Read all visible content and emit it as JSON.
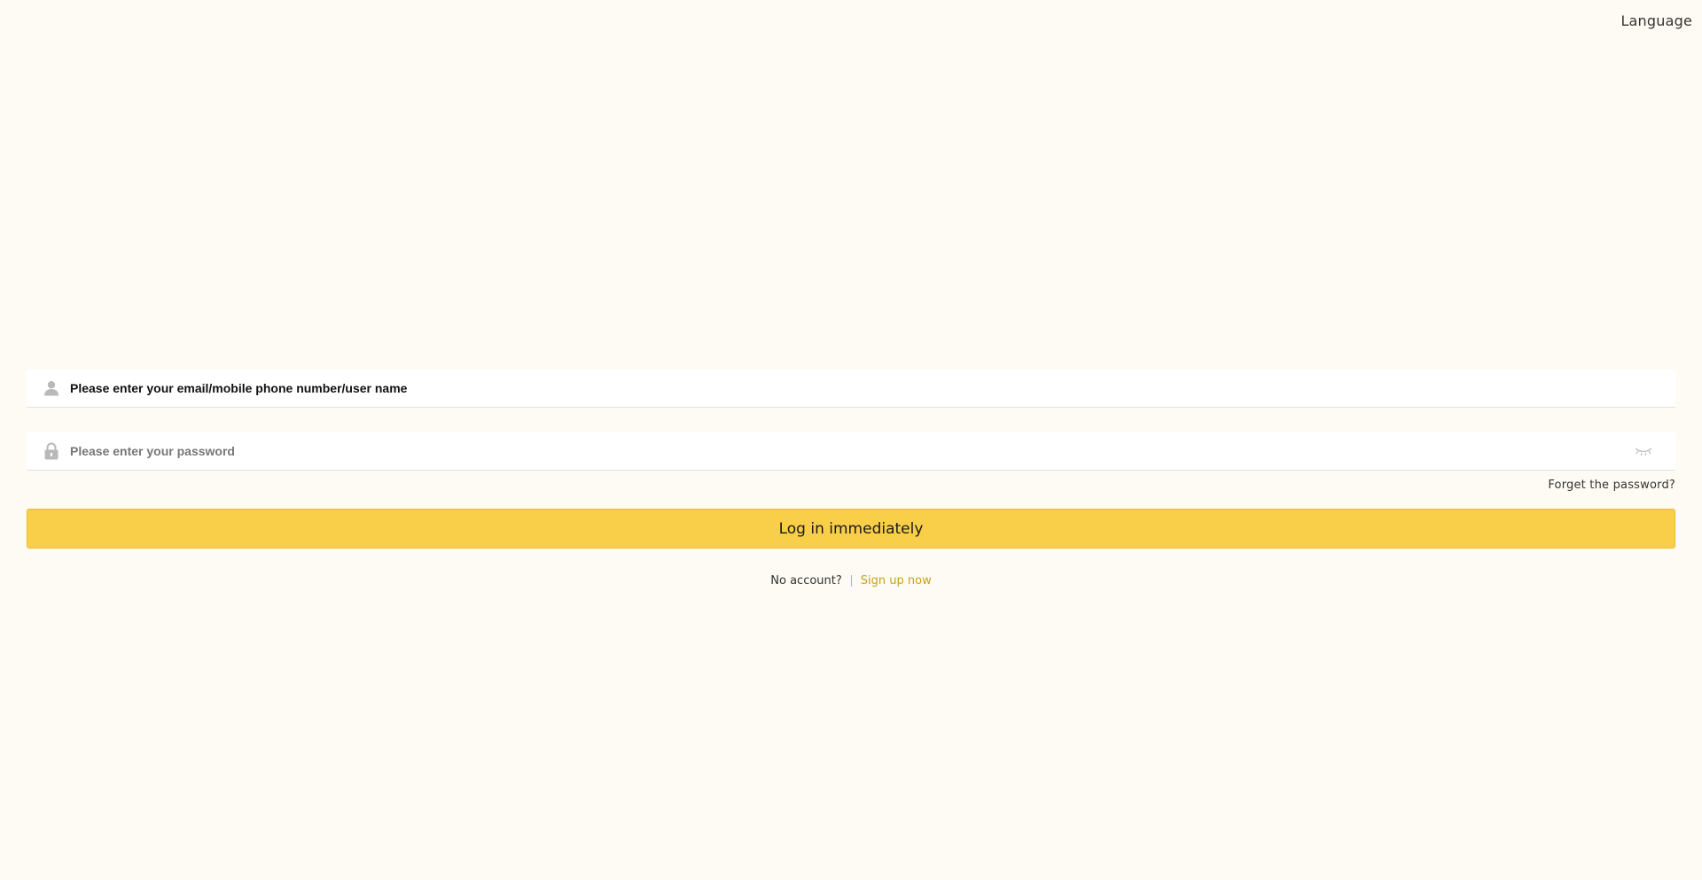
{
  "header": {
    "language_label": "Language"
  },
  "login_form": {
    "account_field": {
      "placeholder": "Please enter your email/mobile phone number/user name",
      "value": "",
      "icon": "user-icon"
    },
    "password_field": {
      "placeholder": "Please enter your password",
      "value": "",
      "icon": "lock-icon",
      "toggle_icon": "eye-closed-icon"
    },
    "forgot_password_label": "Forget the password?",
    "submit_label": "Log in immediately",
    "no_account_label": "No account?",
    "signup_label": "Sign up now"
  },
  "colors": {
    "background": "#fdfbf3",
    "accent": "#f9cf4a",
    "link_gold": "#c9a21a"
  }
}
